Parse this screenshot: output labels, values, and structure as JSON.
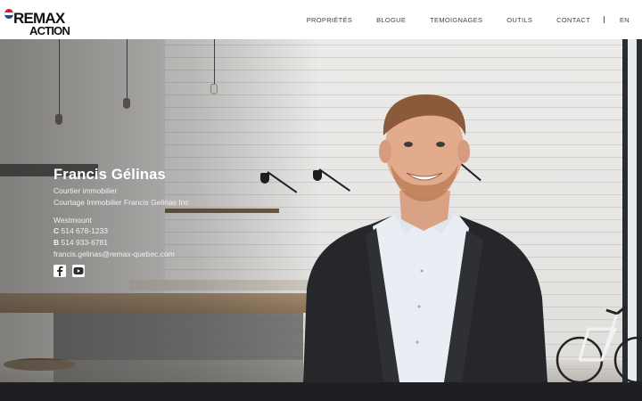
{
  "brand": {
    "name": "REMAX",
    "office": "ACTION",
    "balloon_colors": [
      "#d4202f",
      "#ffffff",
      "#1d4f9c"
    ]
  },
  "nav": {
    "items": [
      {
        "label": "PROPRIÉTÉS"
      },
      {
        "label": "BLOGUE"
      },
      {
        "label": "TEMOIGNAGES"
      },
      {
        "label": "OUTILS"
      },
      {
        "label": "CONTACT"
      }
    ],
    "language": "EN"
  },
  "agent": {
    "name": "Francis Gélinas",
    "title": "Courtier immobilier",
    "agency": "Courtage Immobilier Francis Gelinas Inc",
    "location": "Westmount",
    "cell_prefix": "C",
    "cell": "514 678-1233",
    "office_prefix": "B",
    "office": "514 933-6781",
    "email": "francis.gelinas@remax-quebec.com"
  },
  "social": {
    "facebook_icon": "facebook-icon",
    "youtube_icon": "youtube-icon"
  },
  "colors": {
    "footer": "#1d1f22",
    "text_on_hero": "#ffffff"
  }
}
